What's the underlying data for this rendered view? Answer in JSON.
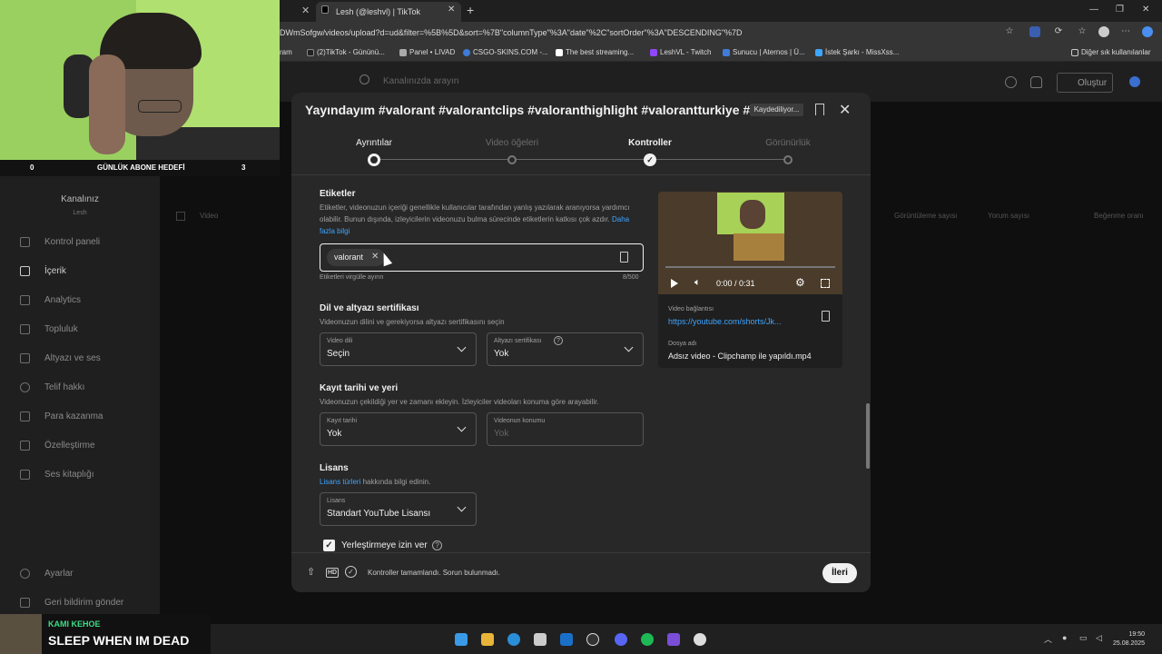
{
  "browser": {
    "tab_title": "Lesh (@leshvl) | TikTok",
    "url": "DWmSofgw/videos/upload?d=ud&filter=%5B%5D&sort=%7B\"columnType\"%3A\"date\"%2C\"sortOrder\"%3A\"DESCENDING\"%7D",
    "bookmarks": [
      "ram",
      "(2)TikTok - Gününü...",
      "Panel • LIVAD",
      "CSGO-SKINS.COM -...",
      "The best streaming...",
      "LeshVL - Twitch",
      "Sunucu | Aternos | Ü...",
      "İstek Şarkı - MissXss..."
    ],
    "other_bookmarks": "Diğer sık kullanılanlar"
  },
  "studio": {
    "search_placeholder": "Kanalınızda arayın",
    "create_label": "Oluştur",
    "channel_label": "Kanalınız",
    "channel_name": "Lesh",
    "sidebar": [
      "Kontrol paneli",
      "İçerik",
      "Analytics",
      "Topluluk",
      "Altyazı ve ses",
      "Telif hakkı",
      "Para kazanma",
      "Özelleştirme",
      "Ses kitaplığı"
    ],
    "sidebar_bottom": [
      "Ayarlar",
      "Geri bildirim gönder"
    ],
    "col_headers": [
      "Video",
      "Görüntüleme sayısı",
      "Yorum sayısı",
      "Beğenme oranı"
    ]
  },
  "webcam": {
    "goal_left": "0",
    "goal_label": "GÜNLÜK ABONE HEDEFİ",
    "goal_right": "3"
  },
  "modal": {
    "title": "Yayındayım #valorant #valorantclips #valoranthighlight #valorantturkiye #...",
    "saving": "Kaydediliyor...",
    "steps": [
      "Ayrıntılar",
      "Video öğeleri",
      "Kontroller",
      "Görünürlük"
    ],
    "tags": {
      "title": "Etiketler",
      "desc": "Etiketler, videonuzun içeriği genellikle kullanıcılar tarafından yanlış yazılarak aranıyorsa yardımcı olabilir. Bunun dışında, izleyicilerin videonuzu bulma sürecinde etiketlerin katkısı çok azdır.",
      "link": "Daha fazla bilgi",
      "chip": "valorant",
      "hint": "Etiketleri virgülle ayırın",
      "count": "8/500"
    },
    "language": {
      "title": "Dil ve altyazı sertifikası",
      "desc": "Videonuzun dilini ve gerekiyorsa altyazı sertifikasını seçin",
      "video_lang_label": "Video dili",
      "video_lang_value": "Seçin",
      "cert_label": "Altyazı sertifikası",
      "cert_value": "Yok"
    },
    "recording": {
      "title": "Kayıt tarihi ve yeri",
      "desc": "Videonuzun çekildiği yer ve zamanı ekleyin. İzleyiciler videoları konuma göre arayabilir.",
      "date_label": "Kayıt tarihi",
      "date_value": "Yok",
      "location_label": "Videonun konumu",
      "location_placeholder": "Yok"
    },
    "license": {
      "title": "Lisans",
      "link": "Lisans türleri",
      "desc": "hakkında bilgi edinin.",
      "label": "Lisans",
      "value": "Standart YouTube Lisansı"
    },
    "embed_label": "Yerleştirmeye izin ver",
    "video": {
      "time": "0:00 / 0:31",
      "link_label": "Video bağlantısı",
      "link": "https://youtube.com/shorts/Jk...",
      "file_label": "Dosya adı",
      "file_name": "Adsız video - Clipchamp ile yapıldı.mp4"
    },
    "footer_status": "Kontroller tamamlandı. Sorun bulunmadı.",
    "footer_hd": "HD",
    "next": "İleri"
  },
  "now_playing": {
    "artist": "KAMI KEHOE",
    "title": "SLEEP WHEN IM DEAD"
  },
  "clock": {
    "time": "19:50",
    "date": "25.08.2025"
  }
}
